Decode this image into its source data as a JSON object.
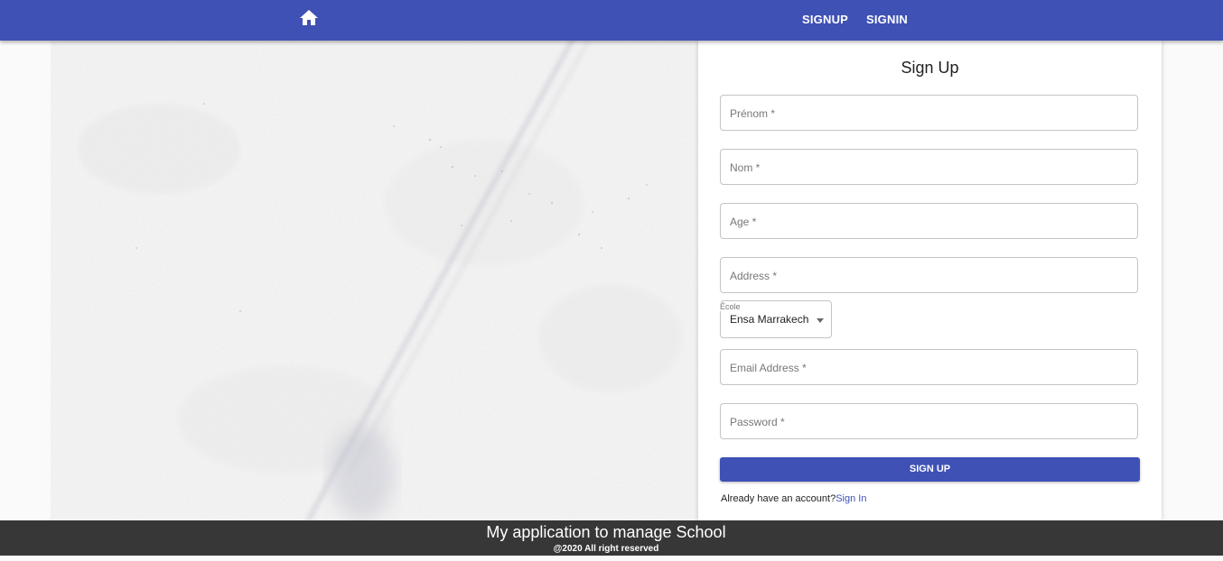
{
  "nav": {
    "home_icon": "home-icon",
    "signup_label": "SIGNUP",
    "signin_label": "SIGNIN"
  },
  "form": {
    "title": "Sign Up",
    "prenom_placeholder": "Prénom *",
    "nom_placeholder": "Nom *",
    "age_placeholder": "Age *",
    "address_placeholder": "Address *",
    "ecole_label": "École",
    "ecole_value": "Ensa Marrakech",
    "email_placeholder": "Email Address *",
    "password_placeholder": "Password *",
    "submit_label": "SIGN UP",
    "signin_prompt": "Already have an account?",
    "signin_link": "Sign In"
  },
  "footer": {
    "title": "My application to manage School",
    "copyright": "@2020 All right reserved"
  },
  "colors": {
    "primary": "#3f51b5",
    "footer_bg": "#373737"
  }
}
